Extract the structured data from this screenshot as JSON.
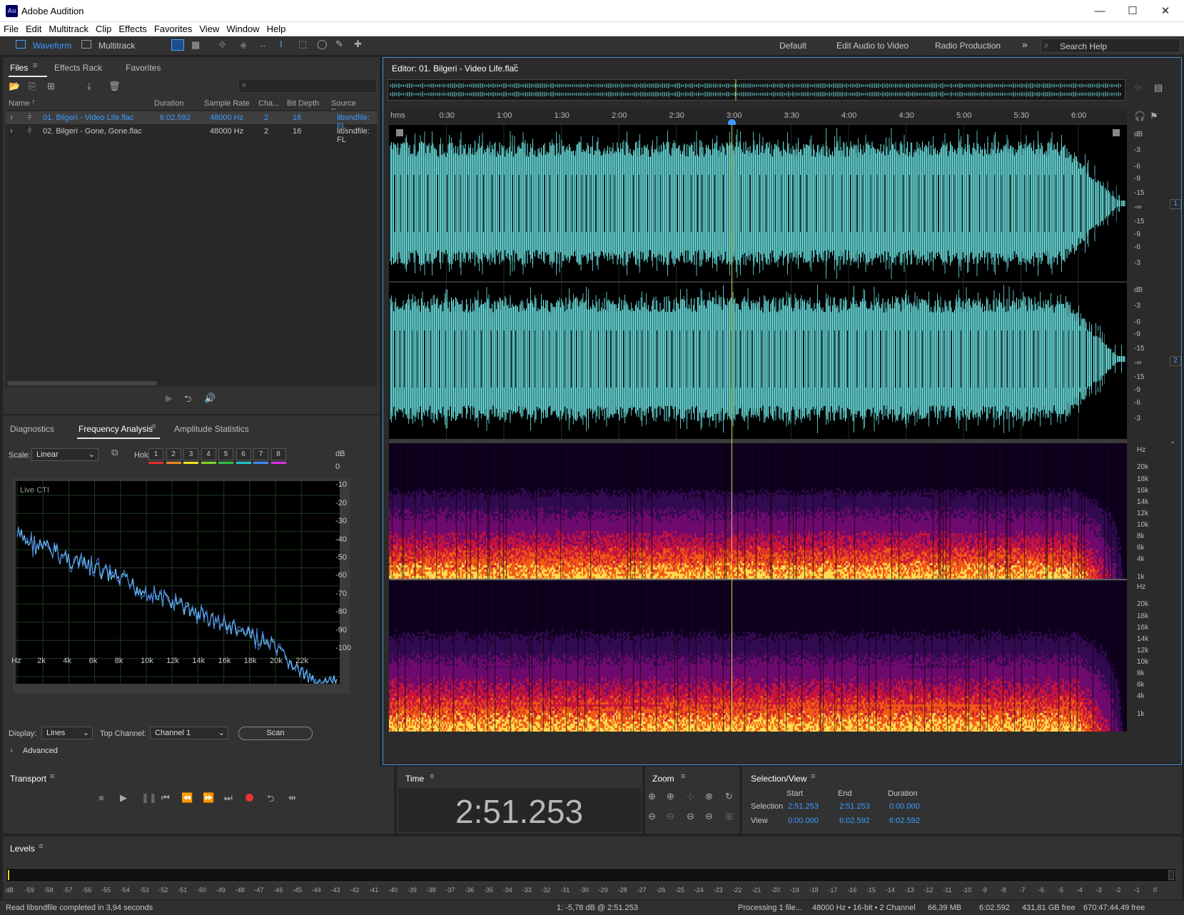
{
  "window": {
    "logo": "Au",
    "title": "Adobe Audition",
    "min": "—",
    "max": "☐",
    "close": "✕"
  },
  "menu": [
    "File",
    "Edit",
    "Multitrack",
    "Clip",
    "Effects",
    "Favorites",
    "View",
    "Window",
    "Help"
  ],
  "toolbar": {
    "waveform": "Waveform",
    "multitrack": "Multitrack",
    "workspaces": [
      "Default",
      "Edit Audio to Video",
      "Radio Production"
    ],
    "more": "»",
    "search_placeholder": "Search Help"
  },
  "files_panel": {
    "tabs": [
      "Files",
      "Effects Rack",
      "Favorites"
    ],
    "columns": [
      "Name",
      "Duration",
      "Sample Rate",
      "Cha...",
      "Bit Depth",
      "Source Forma"
    ],
    "rows": [
      {
        "name": "01. Bilgeri - Video Life.flac",
        "duration": "6:02.592",
        "rate": "48000 Hz",
        "ch": "2",
        "depth": "16",
        "source": "libsndfile: FL"
      },
      {
        "name": "02. Bilgeri - Gone, Gone.flac",
        "duration": "",
        "rate": "48000 Hz",
        "ch": "2",
        "depth": "16",
        "source": "libsndfile: FL"
      }
    ]
  },
  "analysis_panel": {
    "tabs": [
      "Diagnostics",
      "Frequency Analysis",
      "Amplitude Statistics"
    ],
    "scale_label": "Scale:",
    "scale_value": "Linear",
    "hold_label": "Hold:",
    "hold": [
      "1",
      "2",
      "3",
      "4",
      "5",
      "6",
      "7",
      "8"
    ],
    "hold_colors": [
      "#e52b2b",
      "#ef8a1a",
      "#f0e21d",
      "#7fd628",
      "#2fbf42",
      "#20c8c8",
      "#3a8df0",
      "#e02ee0"
    ],
    "live": "Live CTI",
    "db_label": "dB",
    "db_ticks": [
      "0",
      "-10",
      "-20",
      "-30",
      "-40",
      "-50",
      "-60",
      "-70",
      "-80",
      "-90",
      "-100"
    ],
    "hz_ticks": [
      "Hz",
      "2k",
      "4k",
      "6k",
      "8k",
      "10k",
      "12k",
      "14k",
      "16k",
      "18k",
      "20k",
      "22k"
    ],
    "display_label": "Display:",
    "display_value": "Lines",
    "channel_label": "Top Channel:",
    "channel_value": "Channel 1",
    "scan": "Scan",
    "advanced": "Advanced",
    "spectrum_color": "#6fd0ff"
  },
  "editor": {
    "title": "Editor: 01. Bilgeri - Video Life.flac",
    "ruler": [
      "hms",
      "0:30",
      "1:00",
      "1:30",
      "2:00",
      "2:30",
      "3:00",
      "3:30",
      "4:00",
      "4:30",
      "5:00",
      "5:30",
      "6:00"
    ],
    "db_scale": [
      "dB",
      "-3",
      "-6",
      "-9",
      "-15",
      "-∞",
      "-15",
      "-9",
      "-6",
      "-3"
    ],
    "channels": [
      "1",
      "2"
    ],
    "hz_scale": [
      "Hz",
      "20k",
      "18k",
      "16k",
      "14k",
      "12k",
      "10k",
      "8k",
      "6k",
      "4k",
      "1k"
    ],
    "wave_color": "#6ee6e6",
    "playhead_color": "#d8d84a"
  },
  "transport": {
    "title": "Transport"
  },
  "time": {
    "title": "Time",
    "value": "2:51.253"
  },
  "zoom": {
    "title": "Zoom"
  },
  "selection_view": {
    "title": "Selection/View",
    "headers": [
      "Start",
      "End",
      "Duration"
    ],
    "rows": [
      {
        "label": "Selection",
        "start": "2:51.253",
        "end": "2:51.253",
        "duration": "0:00.000"
      },
      {
        "label": "View",
        "start": "0:00.000",
        "end": "6:02.592",
        "duration": "6:02.592"
      }
    ]
  },
  "levels": {
    "title": "Levels",
    "ticks": [
      "dB",
      "-59",
      "-58",
      "-57",
      "-56",
      "-55",
      "-54",
      "-53",
      "-52",
      "-51",
      "-50",
      "-49",
      "-48",
      "-47",
      "-46",
      "-45",
      "-44",
      "-43",
      "-42",
      "-41",
      "-40",
      "-39",
      "-38",
      "-37",
      "-36",
      "-35",
      "-34",
      "-33",
      "-32",
      "-31",
      "-30",
      "-29",
      "-28",
      "-27",
      "-26",
      "-25",
      "-24",
      "-23",
      "-22",
      "-21",
      "-20",
      "-19",
      "-18",
      "-17",
      "-16",
      "-15",
      "-14",
      "-13",
      "-12",
      "-11",
      "-10",
      "-9",
      "-8",
      "-7",
      "-6",
      "-5",
      "-4",
      "-3",
      "-2",
      "-1",
      "0"
    ]
  },
  "status": {
    "left": "Read libsndfile completed in 3,94 seconds",
    "cursor": "1: -5,78 dB @ 2:51.253",
    "processing": "Processing 1 file...",
    "format": "48000 Hz • 16-bit • 2 Channel",
    "size": "66,39 MB",
    "duration": "6:02.592",
    "free": "431,81 GB free",
    "time_free": "670:47:44.49 free"
  }
}
